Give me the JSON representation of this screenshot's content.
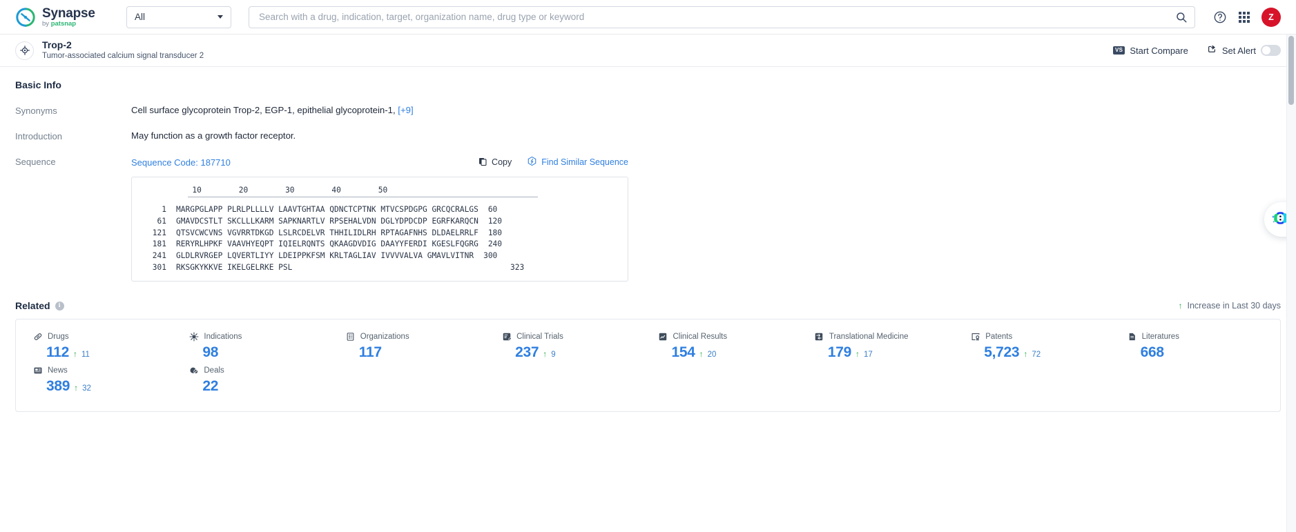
{
  "topnav": {
    "logo_title": "Synapse",
    "logo_sub_prefix": "by ",
    "logo_sub_brand": "patsnap",
    "scope_value": "All",
    "search_placeholder": "Search with a drug, indication, target, organization name, drug type or keyword",
    "search_value": "",
    "avatar_initial": "Z"
  },
  "entity": {
    "title": "Trop-2",
    "subtitle": "Tumor-associated calcium signal transducer 2",
    "start_compare_label": "Start Compare",
    "vs_badge": "VS",
    "set_alert_label": "Set Alert",
    "alert_enabled": false
  },
  "basic_info": {
    "heading": "Basic Info",
    "rows": [
      {
        "label": "Synonyms",
        "value": "Cell surface glycoprotein Trop-2,  EGP-1,  epithelial glycoprotein-1,",
        "more": "[+9]"
      },
      {
        "label": "Introduction",
        "value": "May function as a growth factor receptor."
      }
    ]
  },
  "sequence": {
    "label": "Sequence",
    "code_label": "Sequence Code: 187710",
    "copy_label": "Copy",
    "find_similar_label": "Find Similar Sequence",
    "ruler": "          10        20        30        40        50",
    "lines": [
      {
        "start": "1",
        "chunks": "MARGPGLAPP PLRLPLLLLV LAAVTGHTAA QDNCTCPTNK MTVCSPDGPG GRCQCRALGS",
        "end": "60"
      },
      {
        "start": "61",
        "chunks": "GMAVDCSTLT SKCLLLKARM SAPKNARTLV RPSEHALVDN DGLYDPDCDP EGRFKARQCN",
        "end": "120"
      },
      {
        "start": "121",
        "chunks": "QTSVCWCVNS VGVRRTDKGD LSLRCDELVR THHILIDLRH RPTAGAFNHS DLDAELRRLF",
        "end": "180"
      },
      {
        "start": "181",
        "chunks": "RERYRLHPKF VAAVHYEQPT IQIELRQNTS QKAAGDVDIG DAAYYFERDI KGESLFQGRG",
        "end": "240"
      },
      {
        "start": "241",
        "chunks": "GLDLRVRGEP LQVERTLIYY LDEIPPKFSM KRLTAGLIAV IVVVVALVA GMAVLVITNR",
        "end": "300"
      },
      {
        "start": "301",
        "chunks": "RKSGKYKKVE IKELGELRKE PSL",
        "end": "323"
      }
    ]
  },
  "related": {
    "heading": "Related",
    "legend": "Increase in Last 30 days",
    "items": [
      {
        "name": "Drugs",
        "icon": "capsule-icon",
        "value": "112",
        "delta": "11"
      },
      {
        "name": "Indications",
        "icon": "virus-icon",
        "value": "98",
        "delta": ""
      },
      {
        "name": "Organizations",
        "icon": "building-icon",
        "value": "117",
        "delta": ""
      },
      {
        "name": "Clinical Trials",
        "icon": "clinical-trial-icon",
        "value": "237",
        "delta": "9"
      },
      {
        "name": "Clinical Results",
        "icon": "clinical-result-icon",
        "value": "154",
        "delta": "20"
      },
      {
        "name": "Translational Medicine",
        "icon": "translational-icon",
        "value": "179",
        "delta": "17"
      },
      {
        "name": "Patents",
        "icon": "patent-icon",
        "value": "5,723",
        "delta": "72"
      },
      {
        "name": "Literatures",
        "icon": "literature-icon",
        "value": "668",
        "delta": ""
      },
      {
        "name": "News",
        "icon": "news-icon",
        "value": "389",
        "delta": "32"
      },
      {
        "name": "Deals",
        "icon": "deals-icon",
        "value": "22",
        "delta": ""
      }
    ]
  },
  "colors": {
    "accent_blue": "#2f7fe0",
    "increase_green": "#2cab4a",
    "avatar_red": "#d7132a",
    "brand_green": "#2bb673"
  }
}
